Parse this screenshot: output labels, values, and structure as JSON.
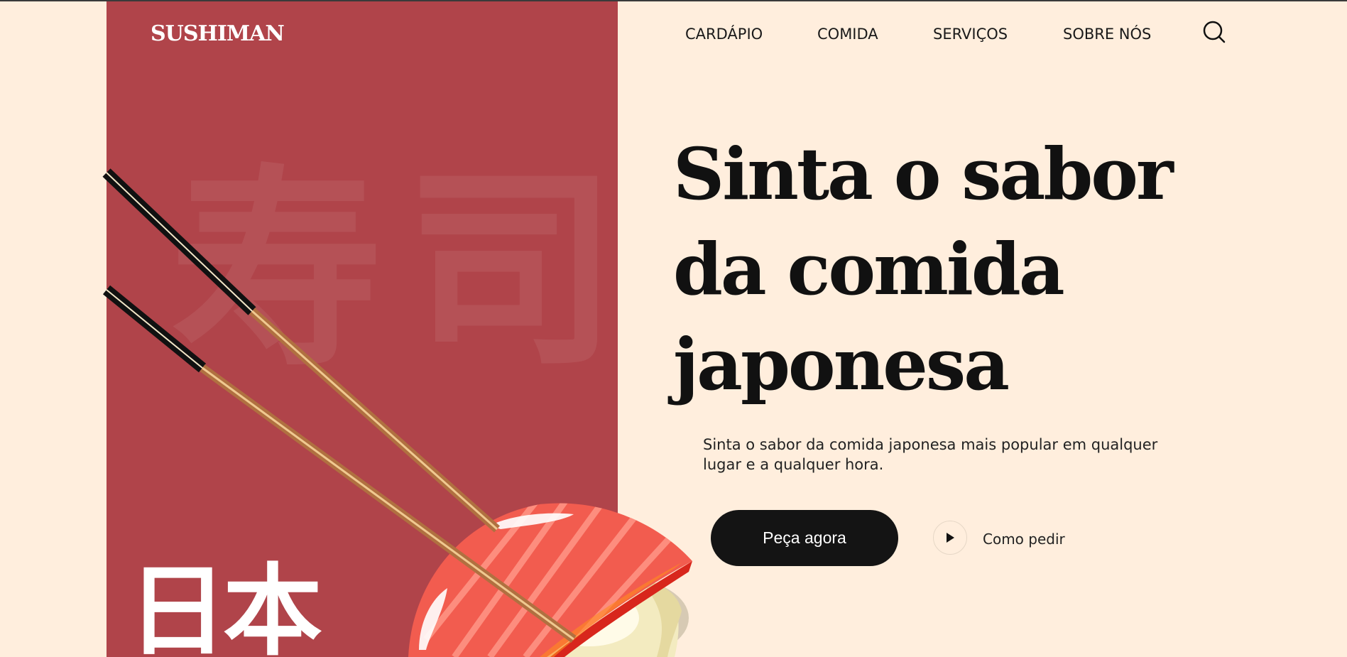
{
  "brand": {
    "logo": "SUSHIMAN"
  },
  "nav": {
    "items": [
      {
        "label": "CARDÁPIO"
      },
      {
        "label": "COMIDA"
      },
      {
        "label": "SERVIÇOS"
      },
      {
        "label": "SOBRE NÓS"
      }
    ],
    "search_icon": "search-icon"
  },
  "hero": {
    "headline": [
      "Sinta o sabor",
      "da comida",
      "japonesa"
    ],
    "subtext": "Sinta o sabor da comida japonesa mais popular em qualquer lugar e a qualquer hora.",
    "cta_label": "Peça agora",
    "secondary_label": "Como pedir",
    "kanji_text": "日本",
    "watermark_text": "寿司"
  },
  "colors": {
    "background": "#FFEEDD",
    "panel_red": "#B0444A",
    "cta_bg": "#141414",
    "text": "#111111"
  }
}
